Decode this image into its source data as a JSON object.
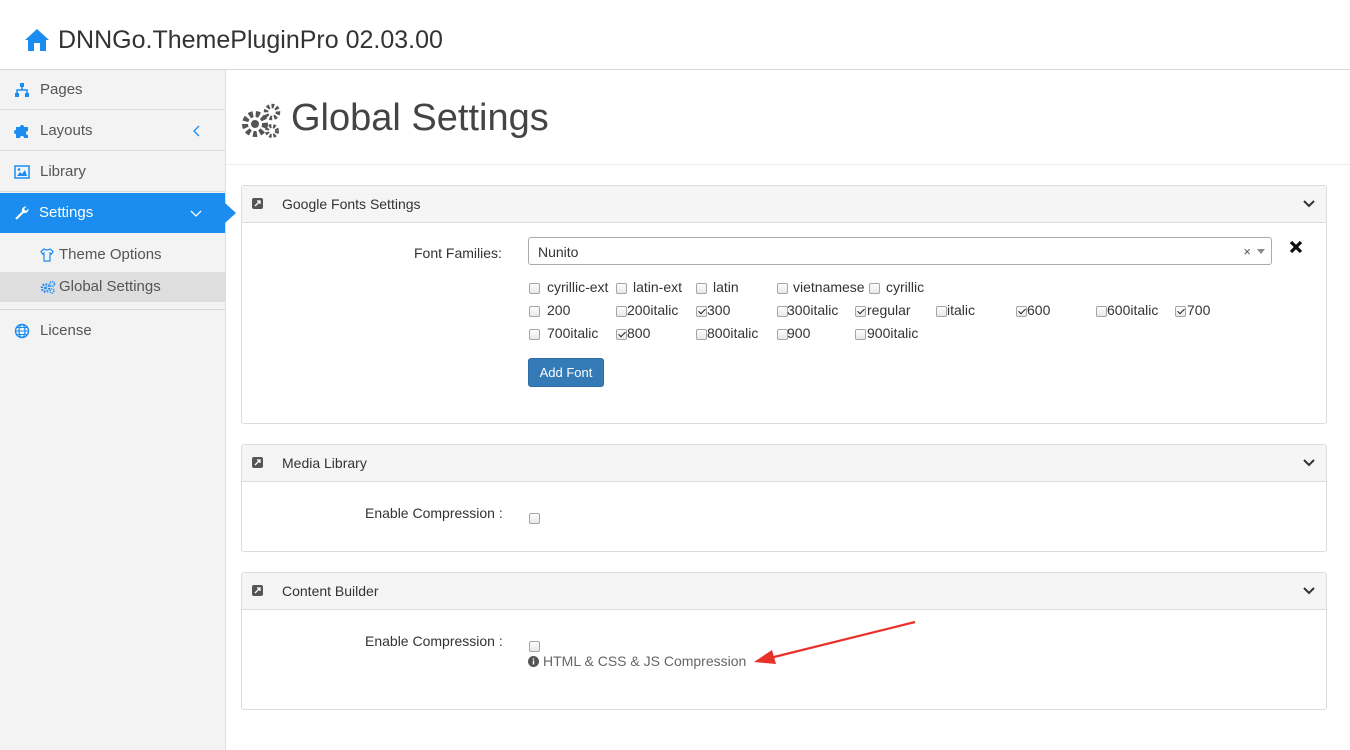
{
  "header": {
    "title": "DNNGo.ThemePluginPro 02.03.00",
    "brand_icon": "home-icon"
  },
  "sidebar": {
    "items": [
      {
        "label": "Pages",
        "icon": "sitemap-icon"
      },
      {
        "label": "Layouts",
        "icon": "puzzle-icon",
        "chevron": "chevron-left-icon"
      },
      {
        "label": "Library",
        "icon": "image-icon"
      },
      {
        "label": "Settings",
        "icon": "wrench-icon",
        "chevron": "chevron-down-icon",
        "active": true
      },
      {
        "label": "License",
        "icon": "globe-icon"
      }
    ],
    "subitems": [
      {
        "label": "Theme Options",
        "icon": "shirt-icon"
      },
      {
        "label": "Global Settings",
        "icon": "gears-icon",
        "current": true
      }
    ],
    "accent_color": "#1b8cf0"
  },
  "page": {
    "title": "Global Settings",
    "icon": "gears-icon"
  },
  "panels": {
    "fonts": {
      "title": "Google Fonts Settings",
      "font_families_label": "Font Families:",
      "selected_font": "Nunito",
      "clear_glyph": "×",
      "subsets": [
        {
          "label": "cyrillic-ext",
          "checked": false
        },
        {
          "label": "latin-ext",
          "checked": false
        },
        {
          "label": "latin",
          "checked": false
        },
        {
          "label": "vietnamese",
          "checked": false
        },
        {
          "label": "cyrillic",
          "checked": false
        }
      ],
      "weights": [
        {
          "label": "200",
          "checked": false
        },
        {
          "label": "200italic",
          "checked": false
        },
        {
          "label": "300",
          "checked": true
        },
        {
          "label": "300italic",
          "checked": false
        },
        {
          "label": "regular",
          "checked": true
        },
        {
          "label": "italic",
          "checked": false
        },
        {
          "label": "600",
          "checked": true
        },
        {
          "label": "600italic",
          "checked": false
        },
        {
          "label": "700",
          "checked": true
        },
        {
          "label": "700italic",
          "checked": false
        },
        {
          "label": "800",
          "checked": true
        },
        {
          "label": "800italic",
          "checked": false
        },
        {
          "label": "900",
          "checked": false
        },
        {
          "label": "900italic",
          "checked": false
        }
      ],
      "add_button": "Add Font"
    },
    "media": {
      "title": "Media Library",
      "compression_label": "Enable Compression :",
      "compression_checked": false
    },
    "content": {
      "title": "Content Builder",
      "compression_label": "Enable Compression :",
      "compression_checked": false,
      "hint": "HTML & CSS & JS Compression"
    }
  },
  "annotation": {
    "arrow_color": "#e8312b"
  }
}
